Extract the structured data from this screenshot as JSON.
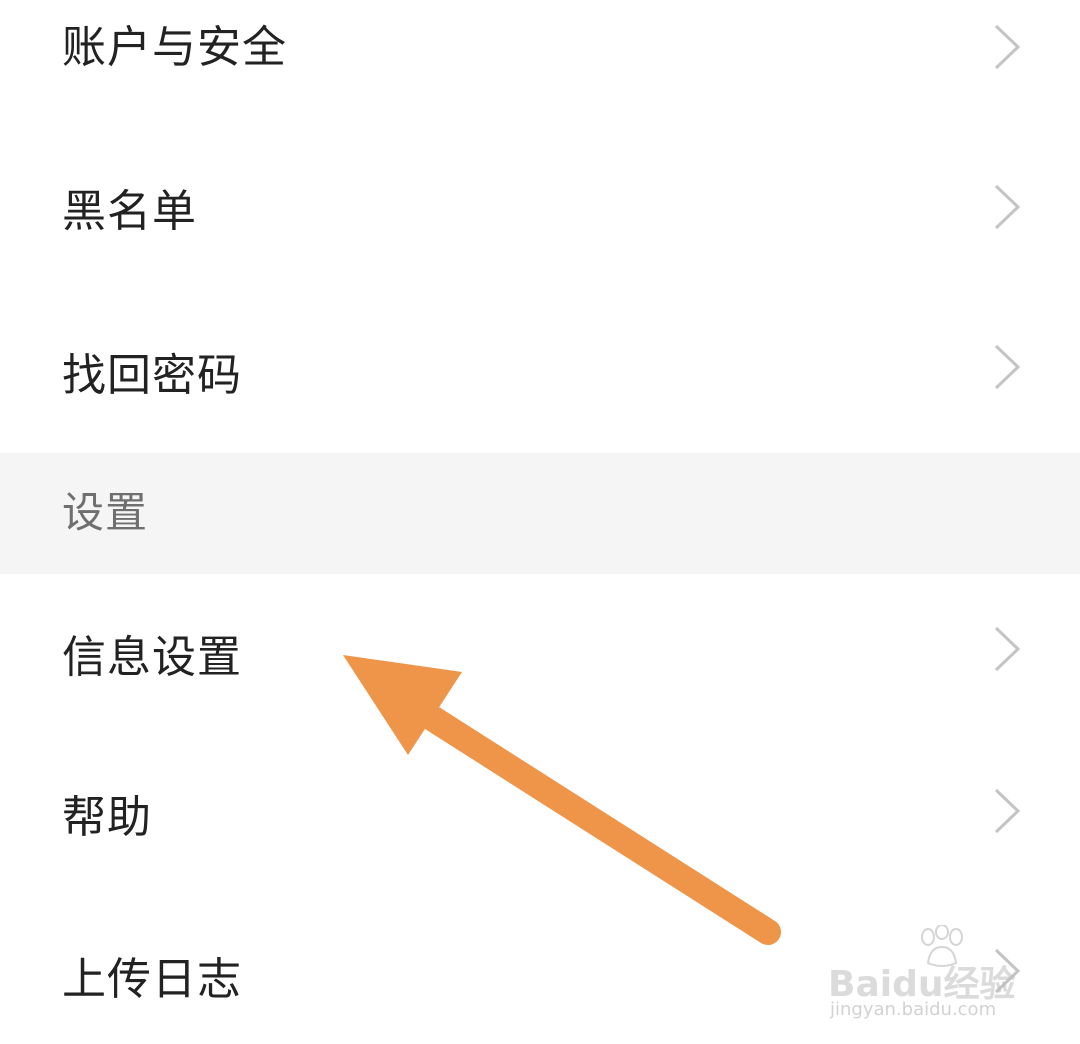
{
  "menu": {
    "items": [
      {
        "label": "账户与安全"
      },
      {
        "label": "黑名单"
      },
      {
        "label": "找回密码"
      }
    ],
    "settings_section": {
      "header": "设置",
      "items": [
        {
          "label": "信息设置"
        },
        {
          "label": "帮助"
        },
        {
          "label": "上传日志"
        }
      ]
    }
  },
  "annotation": {
    "arrow_color": "#EE954A",
    "points_to": "信息设置"
  },
  "watermark": {
    "brand": "Baidu经验",
    "url": "jingyan.baidu.com"
  },
  "icons": {
    "chevron": "chevron-right-icon"
  }
}
